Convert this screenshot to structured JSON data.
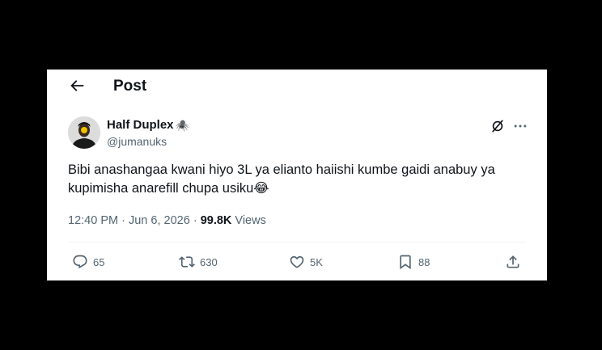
{
  "header": {
    "title": "Post",
    "back_icon": "arrow-left-icon"
  },
  "author": {
    "name": "Half Duplex",
    "emoji": "🕷️",
    "handle": "@jumanuks"
  },
  "post": {
    "text_line1": "Bibi anashangaa kwani hiyo 3L ya elianto haiishi kumbe gaidi anabuy ya",
    "text_line2": "kupimisha anarefill chupa usiku😂",
    "time": "12:40 PM",
    "date": "Jun 6, 2026",
    "separator": "·",
    "views_count": "99.8K",
    "views_label": "Views"
  },
  "actions": {
    "replies": "65",
    "reposts": "630",
    "likes": "5K",
    "bookmarks": "88"
  },
  "colors": {
    "text": "#0f1419",
    "secondary": "#536471",
    "divider": "#eff3f4",
    "background": "#000000"
  }
}
